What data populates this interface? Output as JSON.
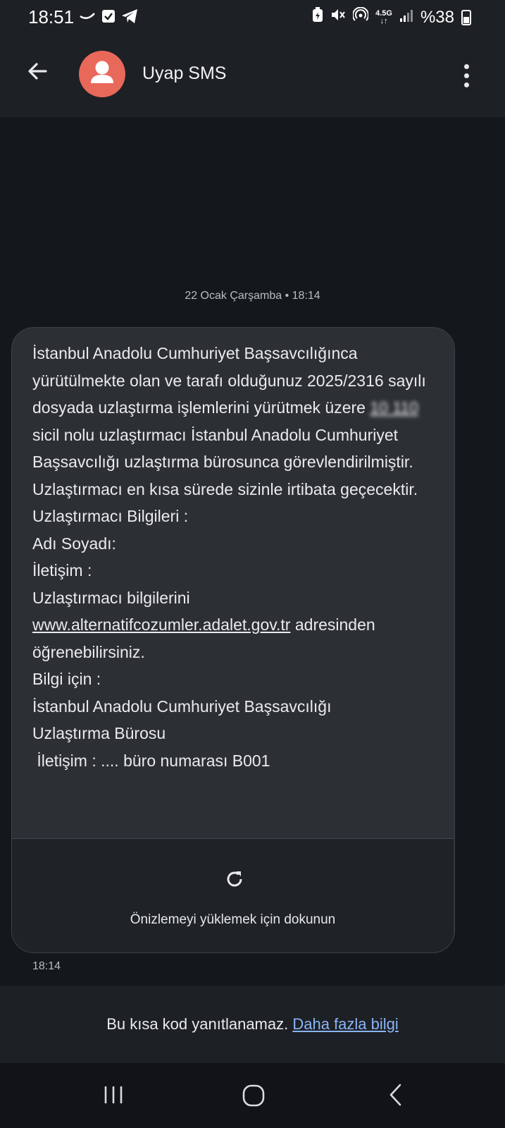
{
  "status_bar": {
    "time": "18:51",
    "left_icons": [
      "swipe-icon",
      "checkbox-icon",
      "telegram-icon"
    ],
    "right_icons": [
      "battery-saver-icon",
      "mute-icon",
      "hotspot-icon",
      "network-4g-icon",
      "signal-icon"
    ],
    "network_type": "4.5G",
    "battery": "%38"
  },
  "header": {
    "back_icon": "arrow-left-icon",
    "contact_name": "Uyap SMS",
    "menu_icon": "more-vert-icon"
  },
  "conversation": {
    "date_label": "22 Ocak Çarşamba • 18:14",
    "message": {
      "text_before_link": "İstanbul Anadolu Cumhuriyet Başsavcılığınca yürütülmekte olan ve tarafı olduğunuz 2025/2316 sayılı dosyada uzlaştırma işlemlerini yürütmek üzere",
      "redacted_sicil": "10 110",
      "text_after_sicil": " sicil nolu uzlaştırmacı İstanbul Anadolu Cumhuriyet Başsavcılığı uzlaştırma bürosunca görevlendirilmiştir.\nUzlaştırmacı en kısa sürede sizinle irtibata geçecektir.\nUzlaştırmacı Bilgileri :\nAdı Soyadı:\nİletişim :\nUzlaştırmacı bilgilerini\n",
      "link": "www.alternatifcozumler.adalet.gov.tr",
      "text_after_link": " adresinden öğrenebilirsiniz.\nBilgi için :\nİstanbul Anadolu Cumhuriyet Başsavcılığı\nUzlaştırma Bürosu\n İletişim : .... büro numarası B001",
      "preview_label": "Önizlemeyi yüklemek için dokunun",
      "preview_icon": "refresh-icon",
      "time": "18:14"
    }
  },
  "footer": {
    "notice": "Bu kısa kod yanıtlanamaz.",
    "more_info_link": "Daha fazla bilgi"
  },
  "nav_bar": {
    "icons": [
      "recents-icon",
      "home-icon",
      "back-icon"
    ]
  },
  "colors": {
    "background": "#14171b",
    "bar": "#1d2024",
    "bubble": "#2c2f34",
    "avatar": "#e8685a",
    "link": "#8ab4f8"
  }
}
